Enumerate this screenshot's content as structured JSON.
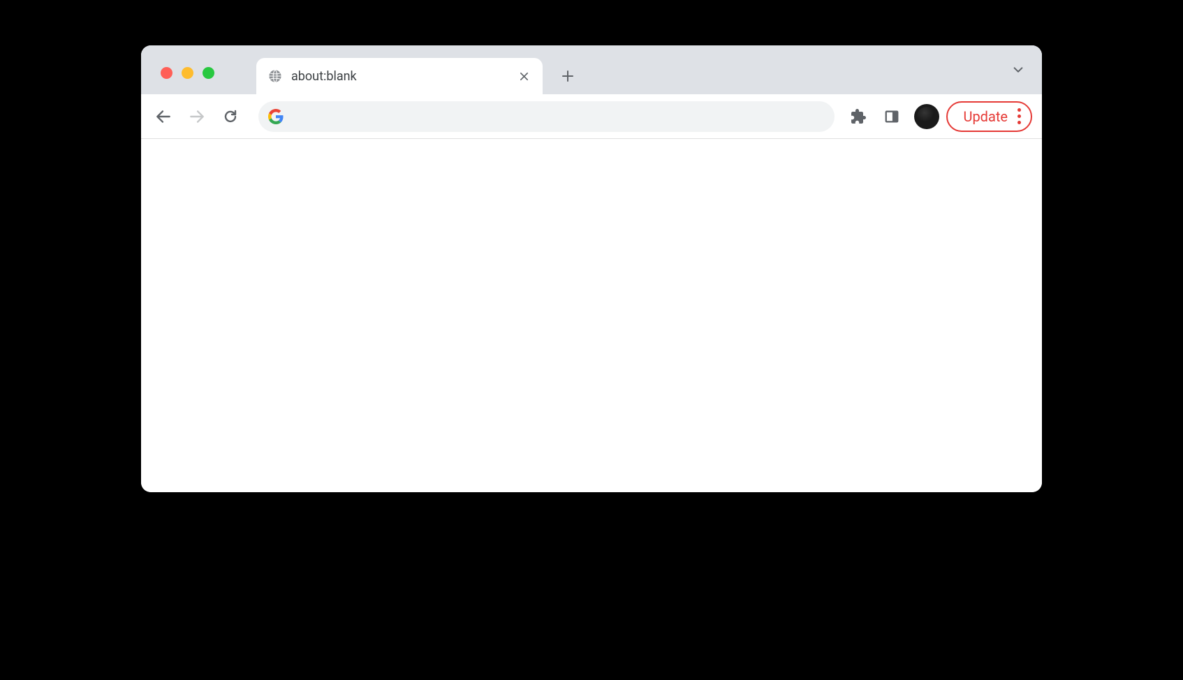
{
  "tab": {
    "title": "about:blank"
  },
  "addressBar": {
    "value": ""
  },
  "update": {
    "label": "Update"
  },
  "colors": {
    "accent": "#e53935",
    "tabStrip": "#dee1e6",
    "addressBg": "#f1f3f4"
  }
}
